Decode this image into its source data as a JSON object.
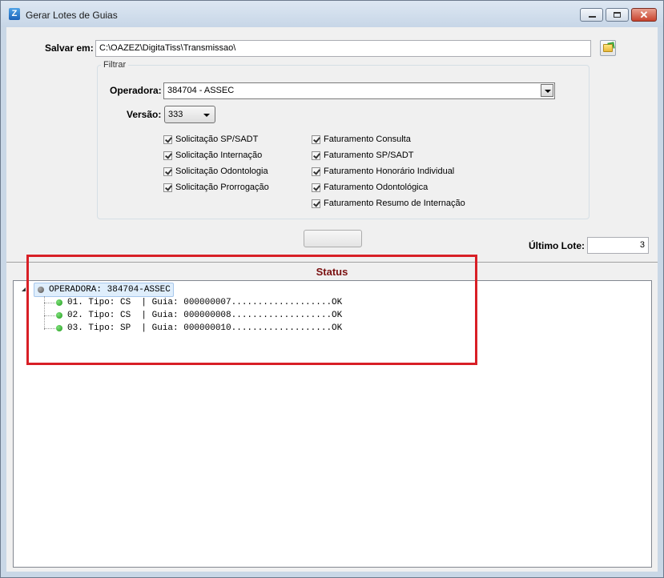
{
  "window": {
    "title": "Gerar Lotes de Guias",
    "icon": "app-icon",
    "close_glyph": "✕"
  },
  "form": {
    "save_label": "Salvar em:",
    "save_path": "C:\\OAZEZ\\DigitaTiss\\Transmissao\\",
    "filter_group": "Filtrar",
    "operator_label": "Operadora:",
    "operator_value": "384704 - ASSEC",
    "version_label": "Versão:",
    "version_value": "333",
    "checkboxes_left": [
      {
        "label": "Solicitação SP/SADT",
        "checked": true
      },
      {
        "label": "Solicitação Internação",
        "checked": true
      },
      {
        "label": "Solicitação Odontologia",
        "checked": true
      },
      {
        "label": "Solicitação Prorrogação",
        "checked": true
      }
    ],
    "checkboxes_right": [
      {
        "label": "Faturamento Consulta",
        "checked": true
      },
      {
        "label": "Faturamento SP/SADT",
        "checked": true
      },
      {
        "label": "Faturamento Honorário Individual",
        "checked": true
      },
      {
        "label": "Faturamento Odontológica",
        "checked": true
      },
      {
        "label": "Faturamento Resumo de Internação",
        "checked": true
      }
    ],
    "last_batch_label": "Último Lote:",
    "last_batch_value": "3"
  },
  "status": {
    "title": "Status",
    "root_label": "OPERADORA: 384704-ASSEC",
    "items": [
      "01. Tipo: CS  | Guia: 000000007...................OK",
      "02. Tipo: CS  | Guia: 000000008...................OK",
      "03. Tipo: SP  | Guia: 000000010...................OK"
    ]
  },
  "colors": {
    "status_title": "#7a1010",
    "highlight_border": "#d81f26",
    "ok_dot": "#1f9b1b"
  }
}
